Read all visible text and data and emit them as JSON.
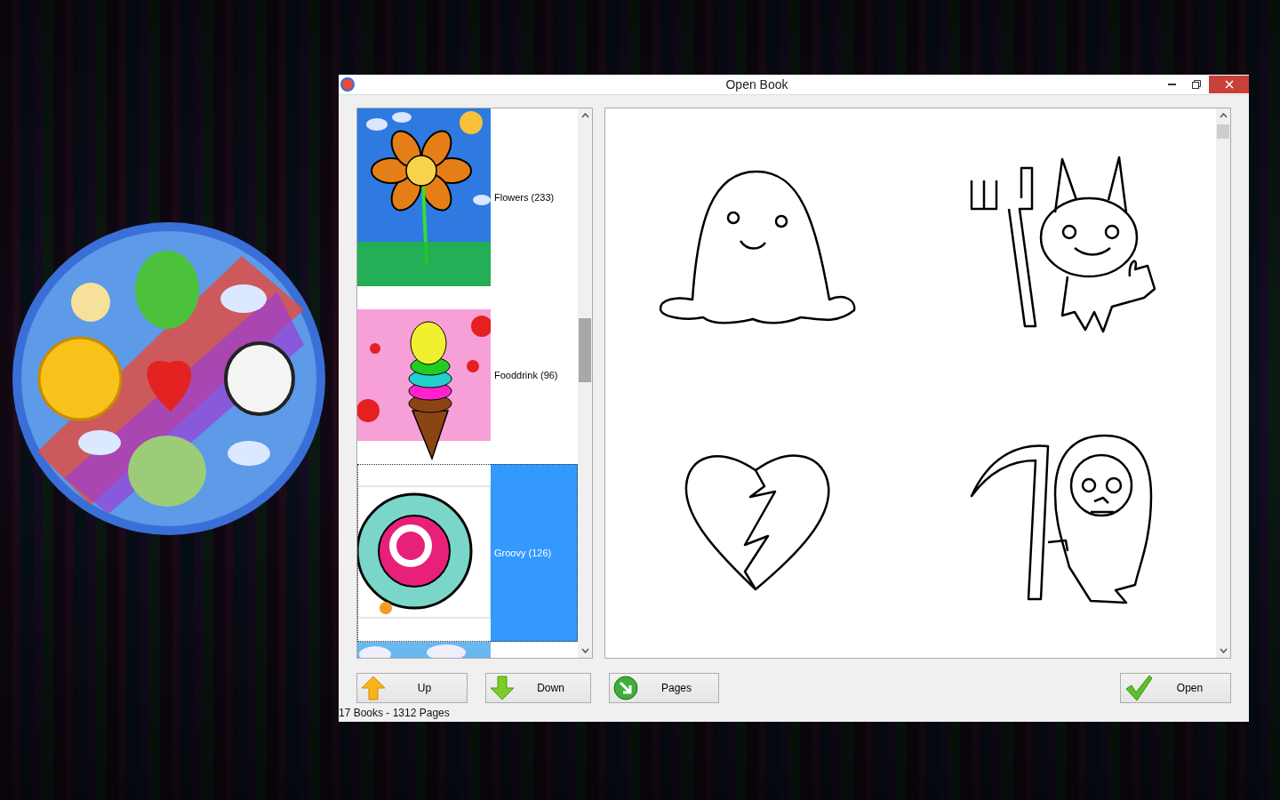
{
  "window": {
    "title": "Open Book"
  },
  "books": [
    {
      "label": "Flowers (233)",
      "kind": "flower",
      "selected": false
    },
    {
      "label": "Fooddrink (96)",
      "kind": "icecream",
      "selected": false
    },
    {
      "label": "Groovy (126)",
      "kind": "spiral",
      "selected": true
    },
    {
      "kind": "clouds",
      "selected": false
    }
  ],
  "pages": [
    {
      "kind": "ghost"
    },
    {
      "kind": "devil"
    },
    {
      "kind": "heart"
    },
    {
      "kind": "reaper"
    }
  ],
  "buttons": [
    {
      "label": "Up",
      "kind": "up"
    },
    {
      "label": "Down",
      "kind": "down"
    },
    {
      "label": "Pages",
      "kind": "pages"
    },
    {
      "label": "Open",
      "kind": "check"
    }
  ],
  "status": "17 Books - 1312 Pages"
}
